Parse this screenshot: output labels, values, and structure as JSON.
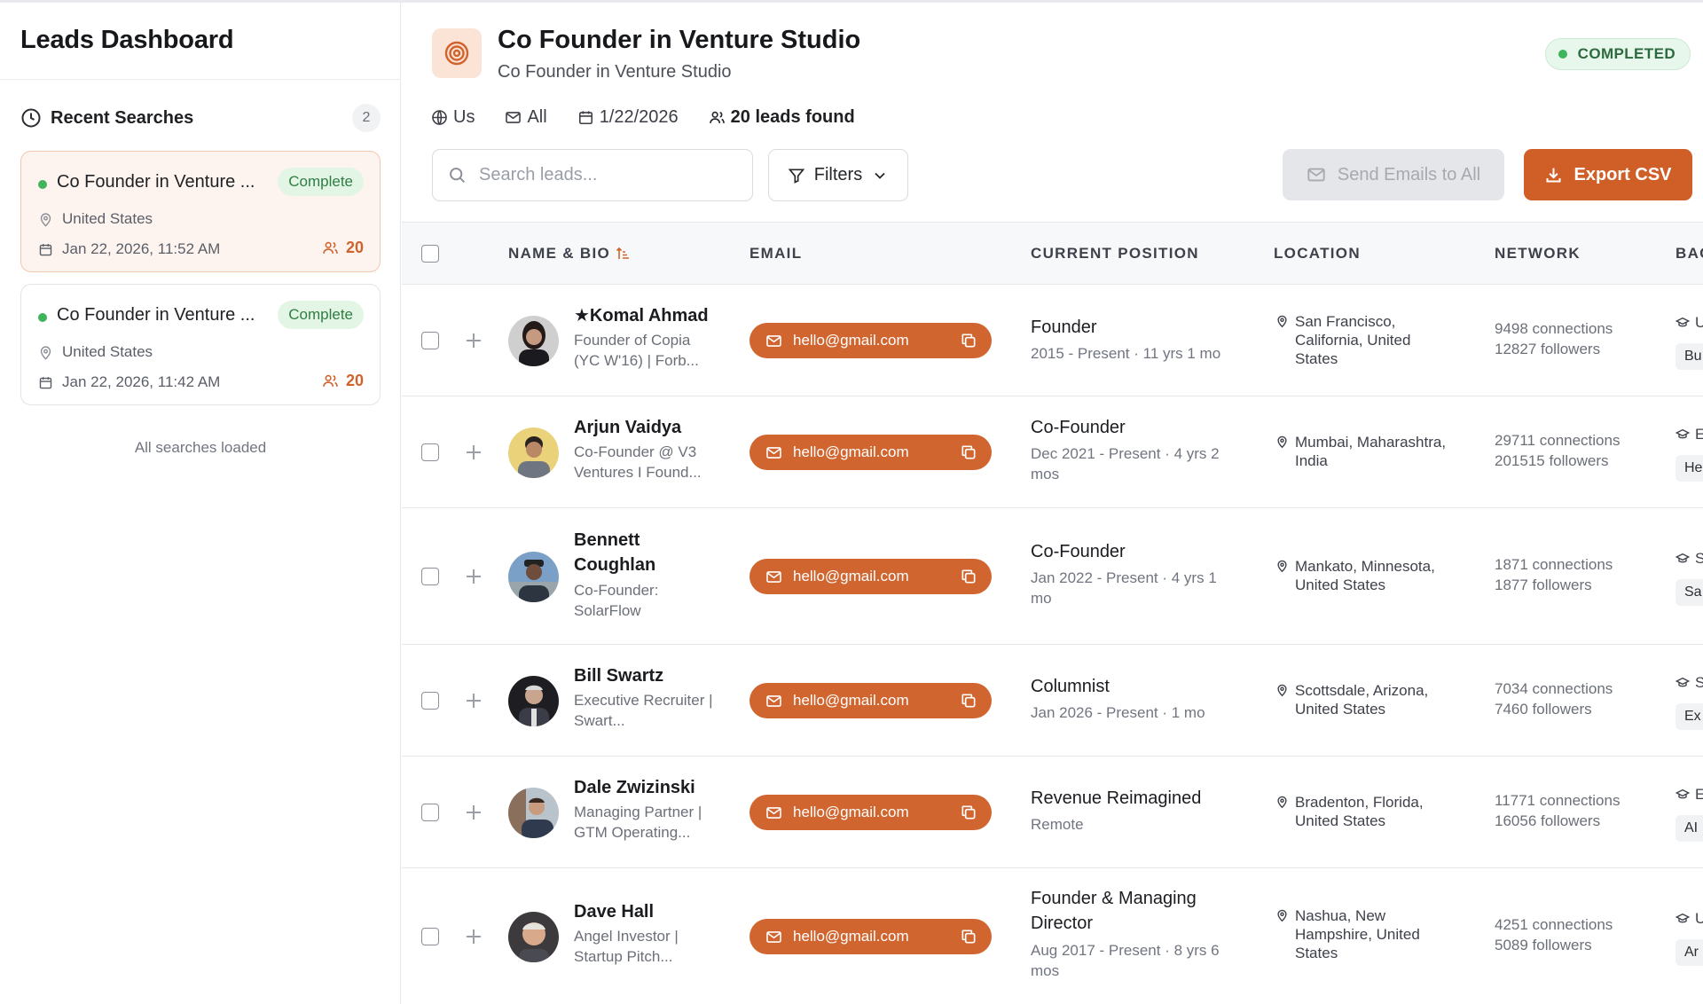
{
  "sidebar": {
    "title": "Leads Dashboard",
    "recent_label": "Recent Searches",
    "recent_count": "2",
    "cards": [
      {
        "title": "Co Founder in Venture ...",
        "badge": "Complete",
        "location": "United States",
        "date": "Jan 22, 2026, 11:52 AM",
        "count": "20"
      },
      {
        "title": "Co Founder in Venture ...",
        "badge": "Complete",
        "location": "United States",
        "date": "Jan 22, 2026, 11:42 AM",
        "count": "20"
      }
    ],
    "loaded_text": "All searches loaded"
  },
  "header": {
    "title": "Co Founder in Venture Studio",
    "subtitle": "Co Founder in Venture Studio",
    "status": "COMPLETED",
    "meta": {
      "region": "Us",
      "email_filter": "All",
      "date": "1/22/2026",
      "leads": "20 leads found"
    }
  },
  "toolbar": {
    "search_placeholder": "Search leads...",
    "filters_label": "Filters",
    "send_label": "Send Emails to All",
    "export_label": "Export CSV"
  },
  "table": {
    "columns": {
      "name": "NAME & BIO",
      "email": "EMAIL",
      "position": "CURRENT POSITION",
      "location": "LOCATION",
      "network": "NETWORK",
      "background": "BAC"
    },
    "rows": [
      {
        "name": "★Komal Ahmad",
        "bio": "Founder of Copia (YC W'16) | Forb...",
        "email": "hello@gmail.com",
        "position": "Founder",
        "tenure": "2015 - Present · 11 yrs 1 mo",
        "location": "San Francisco, California, United States",
        "connections": "9498 connections",
        "followers": "12827 followers",
        "bg_letter": "U",
        "bg_tag": "Bu"
      },
      {
        "name": "Arjun Vaidya",
        "bio": "Co-Founder @ V3 Ventures I Found...",
        "email": "hello@gmail.com",
        "position": "Co-Founder",
        "tenure": "Dec 2021 - Present · 4 yrs 2 mos",
        "location": "Mumbai, Maharashtra, India",
        "connections": "29711 connections",
        "followers": "201515 followers",
        "bg_letter": "E",
        "bg_tag": "He"
      },
      {
        "name": "Bennett Coughlan",
        "bio": "Co-Founder: SolarFlow",
        "email": "hello@gmail.com",
        "position": "Co-Founder",
        "tenure": "Jan 2022 - Present · 4 yrs 1 mo",
        "location": "Mankato, Minnesota, United States",
        "connections": "1871 connections",
        "followers": "1877 followers",
        "bg_letter": "S",
        "bg_tag": "Sa"
      },
      {
        "name": "Bill Swartz",
        "bio": "Executive Recruiter | Swart...",
        "email": "hello@gmail.com",
        "position": "Columnist",
        "tenure": "Jan 2026 - Present · 1 mo",
        "location": "Scottsdale, Arizona, United States",
        "connections": "7034 connections",
        "followers": "7460 followers",
        "bg_letter": "S",
        "bg_tag": "Ex"
      },
      {
        "name": "Dale Zwizinski",
        "bio": "Managing Partner | GTM Operating...",
        "email": "hello@gmail.com",
        "position": "Revenue Reimagined",
        "tenure": "Remote",
        "location": "Bradenton, Florida, United States",
        "connections": "11771 connections",
        "followers": "16056 followers",
        "bg_letter": "E",
        "bg_tag": "AI"
      },
      {
        "name": "Dave Hall",
        "bio": "Angel Investor | Startup Pitch...",
        "email": "hello@gmail.com",
        "position": "Founder & Managing Director",
        "tenure": "Aug 2017 - Present · 8 yrs 6 mos",
        "location": "Nashua, New Hampshire, United States",
        "connections": "4251 connections",
        "followers": "5089 followers",
        "bg_letter": "U",
        "bg_tag": "Ar"
      }
    ]
  },
  "colors": {
    "accent": "#cf5f26",
    "success": "#3fb45a",
    "badge_bg": "#e3f6e6"
  },
  "icons": [
    "clock-icon",
    "map-pin-icon",
    "calendar-icon",
    "users-icon",
    "target-icon",
    "globe-icon",
    "mail-icon",
    "search-icon",
    "filter-icon",
    "chevron-down-icon",
    "download-icon",
    "sort-icon",
    "plus-icon",
    "copy-icon",
    "graduation-cap-icon"
  ]
}
